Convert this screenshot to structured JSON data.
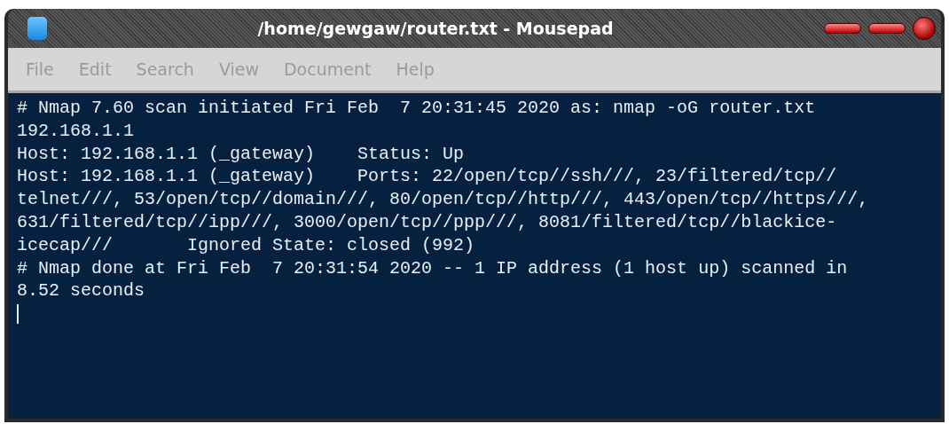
{
  "window": {
    "title": "/home/gewgaw/router.txt - Mousepad"
  },
  "menu": [
    "File",
    "Edit",
    "Search",
    "View",
    "Document",
    "Help"
  ],
  "editor": {
    "lines": [
      "# Nmap 7.60 scan initiated Fri Feb  7 20:31:45 2020 as: nmap -oG router.txt",
      "192.168.1.1",
      "Host: 192.168.1.1 (_gateway)    Status: Up",
      "Host: 192.168.1.1 (_gateway)    Ports: 22/open/tcp//ssh///, 23/filtered/tcp//",
      "telnet///, 53/open/tcp//domain///, 80/open/tcp//http///, 443/open/tcp//https///,",
      "631/filtered/tcp//ipp///, 3000/open/tcp//ppp///, 8081/filtered/tcp//blackice-",
      "icecap///       Ignored State: closed (992)",
      "# Nmap done at Fri Feb  7 20:31:54 2020 -- 1 IP address (1 host up) scanned in",
      "8.52 seconds"
    ]
  }
}
